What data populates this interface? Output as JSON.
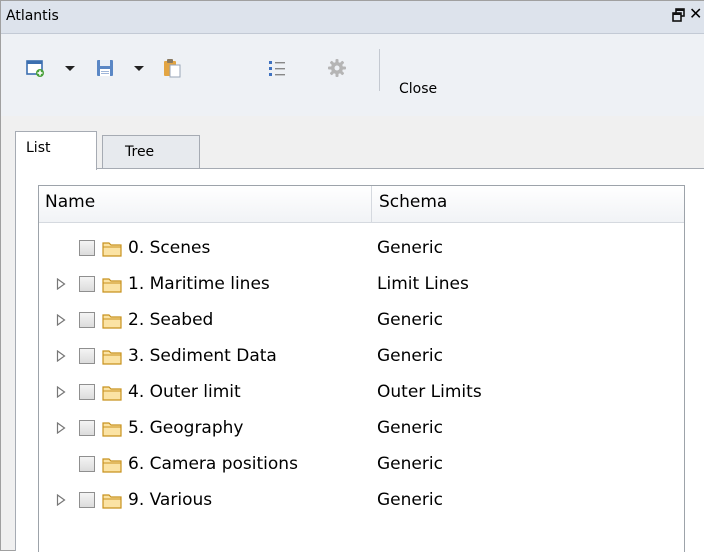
{
  "window": {
    "title": "Atlantis"
  },
  "toolbar": {
    "icons": [
      "new-layer-icon",
      "dropdown-arrow-icon",
      "save-icon",
      "dropdown-arrow-icon",
      "paste-icon",
      "list-icon",
      "gear-icon"
    ],
    "close_label": "Close"
  },
  "tabs": [
    {
      "label": "List",
      "active": true
    },
    {
      "label": "Tree",
      "active": false
    }
  ],
  "table": {
    "columns": [
      "Name",
      "Schema"
    ],
    "rows": [
      {
        "name": "0. Scenes",
        "schema": "Generic",
        "expandable": false
      },
      {
        "name": "1. Maritime lines",
        "schema": "Limit Lines",
        "expandable": true
      },
      {
        "name": "2. Seabed",
        "schema": "Generic",
        "expandable": true
      },
      {
        "name": "3. Sediment Data",
        "schema": "Generic",
        "expandable": true
      },
      {
        "name": "4. Outer limit",
        "schema": "Outer Limits",
        "expandable": true
      },
      {
        "name": "5. Geography",
        "schema": "Generic",
        "expandable": true
      },
      {
        "name": "6. Camera positions",
        "schema": "Generic",
        "expandable": false
      },
      {
        "name": "9. Various",
        "schema": "Generic",
        "expandable": true
      }
    ]
  },
  "colors": {
    "titlebar": "#dde3ec",
    "toolbar": "#eef1f5",
    "folder": "#e9b949"
  }
}
